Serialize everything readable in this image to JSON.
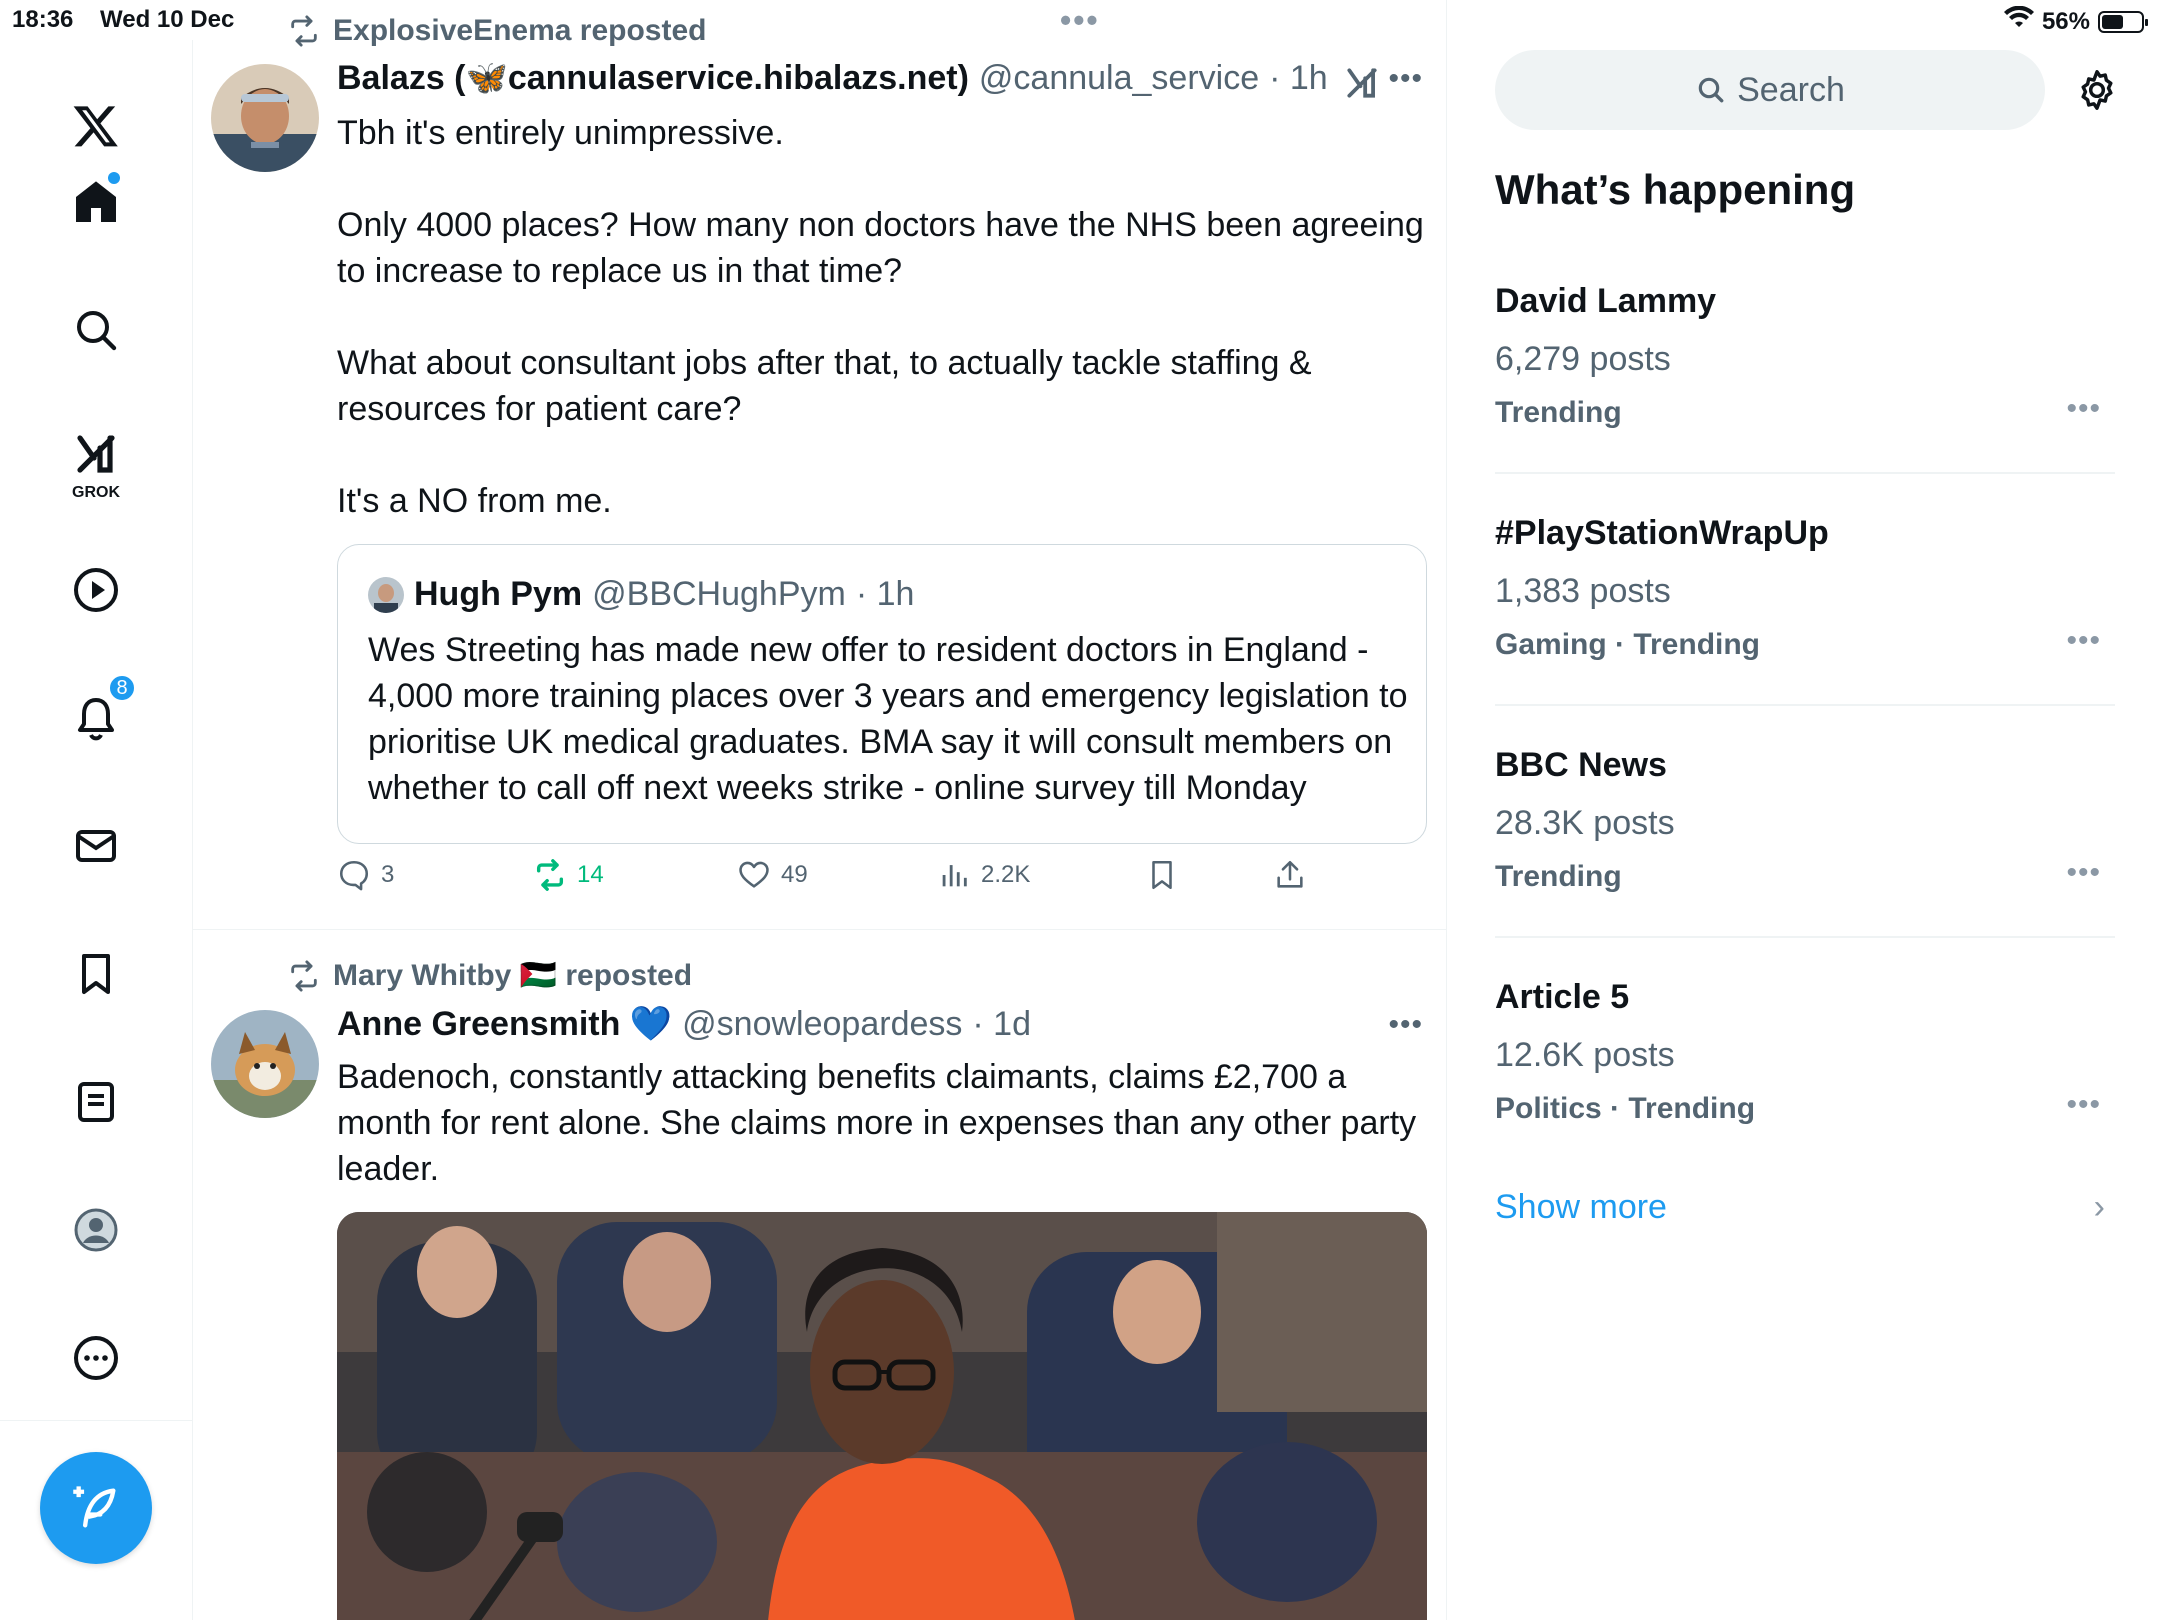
{
  "status_bar": {
    "time": "18:36",
    "date": "Wed 10 Dec",
    "battery_text": "56%",
    "battery_level": 0.56
  },
  "nav": {
    "items": [
      {
        "icon": "x-logo-icon"
      },
      {
        "icon": "home-icon",
        "has_dot": true
      },
      {
        "icon": "search-icon"
      },
      {
        "icon": "grok-icon",
        "label": "GROK"
      },
      {
        "icon": "video-icon"
      },
      {
        "icon": "bell-icon",
        "badge": "8"
      },
      {
        "icon": "mail-icon"
      },
      {
        "icon": "bookmark-icon"
      },
      {
        "icon": "list-icon"
      },
      {
        "icon": "profile-icon"
      },
      {
        "icon": "more-icon"
      }
    ],
    "notification_badge": "8",
    "grok_label": "GROK",
    "compose_icon": "compose-feather-icon"
  },
  "feed": {
    "post1": {
      "reposted_by": "ExplosiveEnema reposted",
      "author_name": "Balazs (🦋cannulaservice.hibalazs.net)",
      "handle": "@cannula_service",
      "time": "· 1h",
      "paragraphs": [
        "Tbh it's entirely unimpressive.",
        "Only 4000 places? How many non doctors have the NHS been agreeing to increase to replace us in that time?",
        "What about consultant jobs after that, to actually tackle staffing & resources for patient care?",
        "It's a NO from me."
      ],
      "quote": {
        "author_name": "Hugh Pym",
        "handle": "@BBCHughPym",
        "time": "· 1h",
        "text": "Wes Streeting has made new offer to resident doctors in England - 4,000 more training places over 3 years and emergency legislation to prioritise UK medical graduates. BMA say it will consult members on whether to call off next weeks strike - online survey till Monday"
      },
      "actions": {
        "replies": "3",
        "reposts": "14",
        "likes": "49",
        "views": "2.2K"
      }
    },
    "post2": {
      "reposted_by": "Mary Whitby 🇵🇸 reposted",
      "author_name": "Anne Greensmith 💙",
      "handle": "@snowleopardess",
      "time": "· 1d",
      "text": "Badenoch, constantly attacking benefits claimants, claims £2,700 a month for rent alone. She claims more in expenses than any other party leader."
    }
  },
  "sidebar": {
    "search_placeholder": "Search",
    "section_title": "What’s happening",
    "trends": [
      {
        "name": "David Lammy",
        "count": "6,279 posts",
        "meta": "Trending"
      },
      {
        "name": "#PlayStationWrapUp",
        "count": "1,383 posts",
        "meta": "Gaming · Trending"
      },
      {
        "name": "BBC News",
        "count": "28.3K posts",
        "meta": "Trending"
      },
      {
        "name": "Article 5",
        "count": "12.6K posts",
        "meta": "Politics · Trending"
      }
    ],
    "show_more": "Show more"
  },
  "colors": {
    "accent": "#1d9bf0",
    "repost_green": "#00ba7c",
    "muted_text": "#536471",
    "border": "#eff3f4"
  }
}
